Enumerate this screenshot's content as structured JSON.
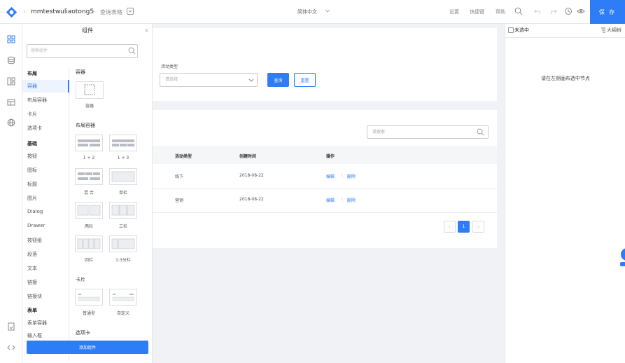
{
  "header": {
    "app_name": "mmtestwuliaotong5",
    "page_name": "查询表格",
    "language": "简体中文",
    "links": [
      "设置",
      "快捷键",
      "帮助"
    ],
    "save_label": "保 存",
    "accent": "#2e7cf6"
  },
  "rail": {
    "icons": [
      "grid-icon",
      "database-icon",
      "components-icon",
      "table-icon",
      "globe-icon",
      "document-icon",
      "code-icon"
    ]
  },
  "component_panel": {
    "title": "组件",
    "search_placeholder": "搜索组件",
    "categories": [
      {
        "type": "head",
        "label": "布局"
      },
      {
        "type": "item",
        "label": "容器",
        "active": true
      },
      {
        "type": "item",
        "label": "布局容器"
      },
      {
        "type": "item",
        "label": "卡片"
      },
      {
        "type": "item",
        "label": "选项卡"
      },
      {
        "type": "head",
        "label": "基础"
      },
      {
        "type": "item",
        "label": "按钮"
      },
      {
        "type": "item",
        "label": "图标"
      },
      {
        "type": "item",
        "label": "标题"
      },
      {
        "type": "item",
        "label": "图片"
      },
      {
        "type": "item",
        "label": "Dialog"
      },
      {
        "type": "item",
        "label": "Drawer"
      },
      {
        "type": "item",
        "label": "按钮组"
      },
      {
        "type": "item",
        "label": "段落"
      },
      {
        "type": "item",
        "label": "文本"
      },
      {
        "type": "item",
        "label": "链接"
      },
      {
        "type": "item",
        "label": "链接块"
      },
      {
        "type": "head",
        "label": "表单"
      },
      {
        "type": "item",
        "label": "表单容器"
      },
      {
        "type": "item",
        "label": "输入框"
      }
    ],
    "sections": {
      "container": "容器",
      "layout": "布局容器",
      "card": "卡片",
      "tabs": "选项卡"
    },
    "tiles": {
      "container": "容器",
      "layout": [
        "1 + 2",
        "1 + 3",
        "混 合",
        "单栏",
        "两栏",
        "三栏",
        "四栏",
        "1:3分栏"
      ],
      "card": [
        "普通型",
        "自定义"
      ]
    },
    "add_label": "添加组件"
  },
  "canvas": {
    "filter": {
      "label": "活动类型",
      "placeholder": "请选择",
      "query_label": "查询",
      "reset_label": "重置"
    },
    "table": {
      "search_placeholder": "请搜索",
      "columns": [
        "活动类型",
        "创建时间",
        "操作"
      ],
      "rows": [
        {
          "type": "线下",
          "date": "2018-08-22",
          "edit": "编辑",
          "sep": "|",
          "delete": "删除"
        },
        {
          "type": "营销",
          "date": "2018-08-22",
          "edit": "编辑",
          "sep": "|",
          "delete": "删除"
        }
      ],
      "page": "1"
    }
  },
  "right_panel": {
    "unselected_label": "未选中",
    "outline_label": "大纲树",
    "hint": "请在左侧画布选中节点"
  }
}
